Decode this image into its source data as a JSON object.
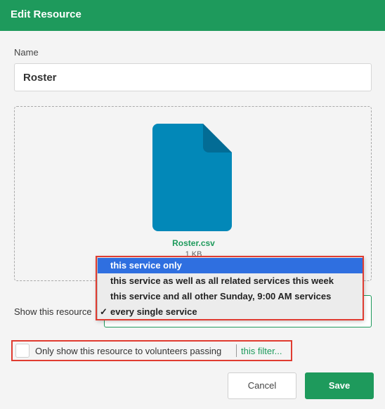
{
  "dialog": {
    "title": "Edit Resource"
  },
  "name_field": {
    "label": "Name",
    "value": "Roster"
  },
  "file": {
    "icon": "document-icon",
    "name": "Roster.csv",
    "size": "1 KB",
    "color": "#0288b8"
  },
  "visibility": {
    "label": "Show this resource",
    "options": [
      "this service only",
      "this service as well as all related services this week",
      "this service and all other Sunday, 9:00 AM services",
      "every single service"
    ],
    "checkmark": "✓",
    "highlighted_option": "this service only",
    "checked_option": "every single service"
  },
  "filter": {
    "label": "Only show this resource to volunteers passing",
    "link": "this filter...",
    "checked": false
  },
  "buttons": {
    "cancel": "Cancel",
    "save": "Save"
  },
  "colors": {
    "brand": "#1e9a5c",
    "highlight": "#2f6fe0",
    "annotation": "#e03c31"
  }
}
